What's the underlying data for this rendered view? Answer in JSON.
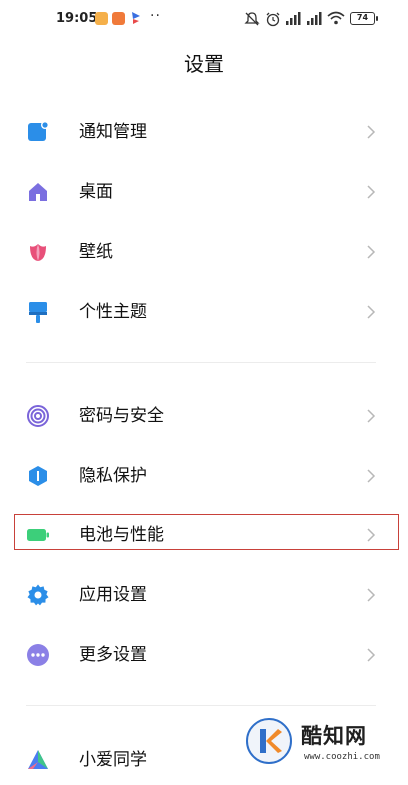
{
  "status_bar": {
    "time": "19:05",
    "more": "··",
    "battery": "74"
  },
  "page": {
    "title": "设置"
  },
  "items": [
    {
      "label": "通知管理",
      "icon": "notification-icon",
      "color": "#2b8ee8"
    },
    {
      "label": "桌面",
      "icon": "home-icon",
      "color": "#7b6fe0"
    },
    {
      "label": "壁纸",
      "icon": "tulip-icon",
      "color": "#e8507a"
    },
    {
      "label": "个性主题",
      "icon": "brush-icon",
      "color": "#2b8ee8"
    },
    {
      "label": "密码与安全",
      "icon": "fingerprint-icon",
      "color": "#7a64d9"
    },
    {
      "label": "隐私保护",
      "icon": "privacy-shield-icon",
      "color": "#2b8ee8"
    },
    {
      "label": "电池与性能",
      "icon": "battery-icon",
      "color": "#3ccf7a"
    },
    {
      "label": "应用设置",
      "icon": "gear-icon",
      "color": "#2b8ee8"
    },
    {
      "label": "更多设置",
      "icon": "more-dots-icon",
      "color": "#8b80e6"
    },
    {
      "label": "小爱同学",
      "icon": "xiaoai-icon",
      "color": "#4a7df0"
    }
  ],
  "watermark": {
    "brand": "酷知网",
    "url": "www.coozhi.com"
  }
}
